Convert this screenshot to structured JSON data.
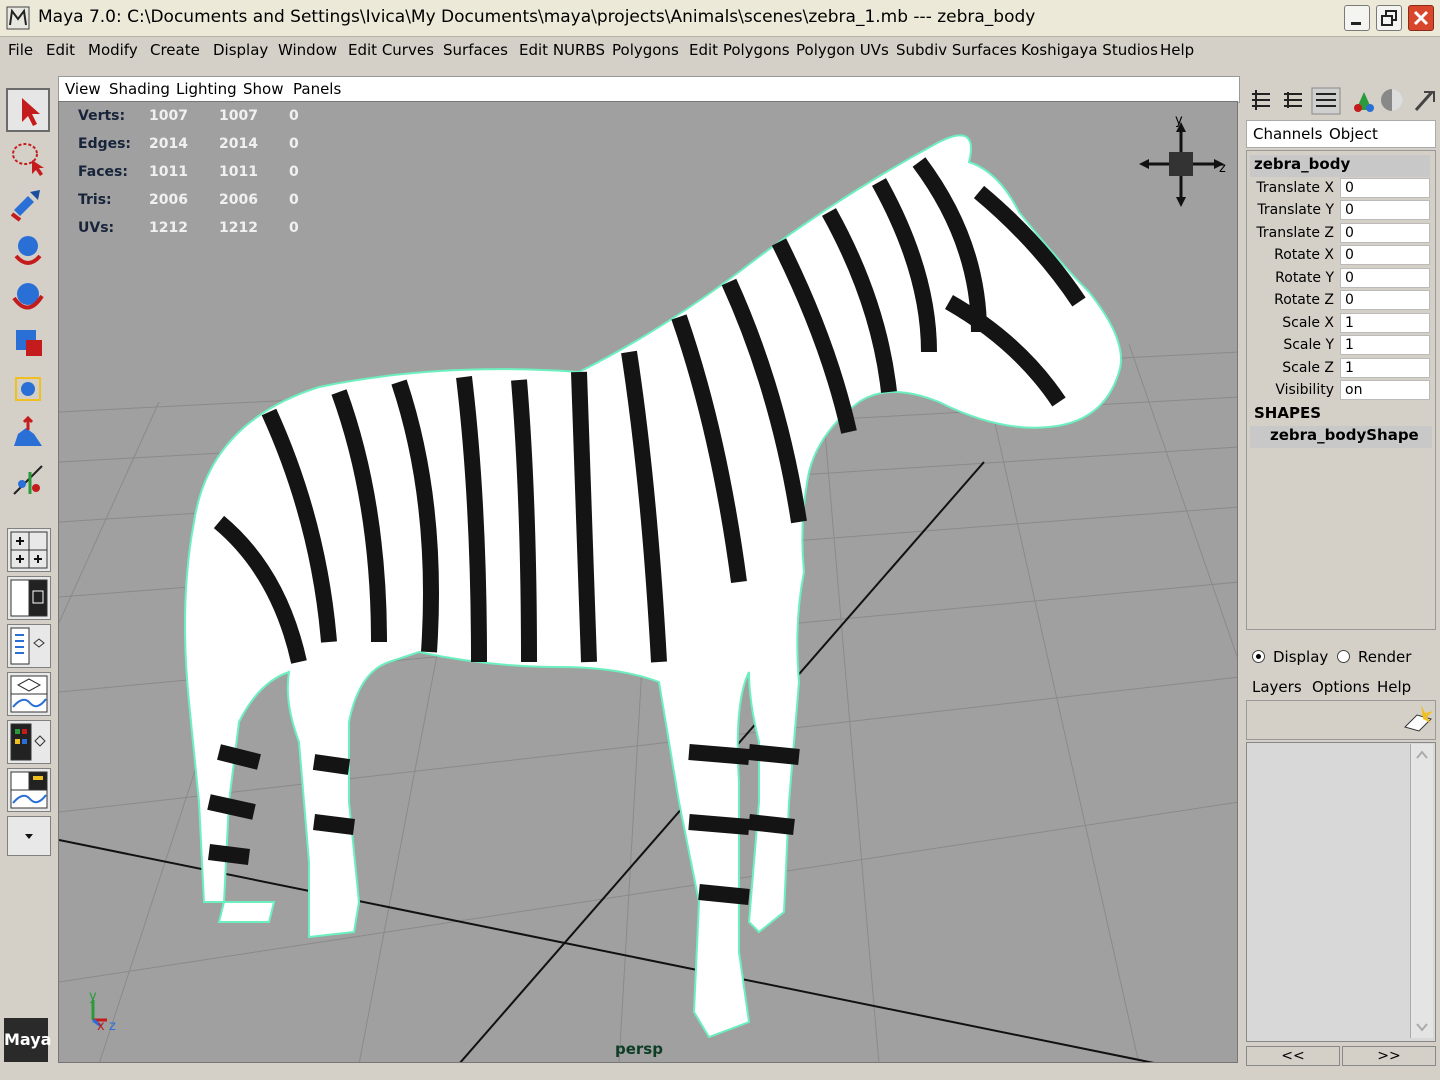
{
  "window": {
    "title": "Maya 7.0: C:\\Documents and Settings\\Ivica\\My Documents\\maya\\projects\\Animals\\scenes\\zebra_1.mb   ---   zebra_body"
  },
  "menubar": [
    "File",
    "Edit",
    "Modify",
    "Create",
    "Display",
    "Window",
    "Edit Curves",
    "Surfaces",
    "Edit NURBS",
    "Polygons",
    "Edit Polygons",
    "Polygon UVs",
    "Subdiv Surfaces",
    "Koshigaya Studios",
    "Help"
  ],
  "panel_menu": [
    "View",
    "Shading",
    "Lighting",
    "Show",
    "Panels"
  ],
  "hud": {
    "rows": [
      {
        "label": "Verts:",
        "a": "1007",
        "b": "1007",
        "c": "0"
      },
      {
        "label": "Edges:",
        "a": "2014",
        "b": "2014",
        "c": "0"
      },
      {
        "label": "Faces:",
        "a": "1011",
        "b": "1011",
        "c": "0"
      },
      {
        "label": "Tris:",
        "a": "2006",
        "b": "2006",
        "c": "0"
      },
      {
        "label": "UVs:",
        "a": "1212",
        "b": "1212",
        "c": "0"
      }
    ]
  },
  "viewport": {
    "camera": "persp",
    "view_cube": {
      "y": "y",
      "z": "z"
    },
    "axis": {
      "y": "y",
      "x": "x",
      "z": "z"
    }
  },
  "channel_box": {
    "tabs": [
      "Channels",
      "Object"
    ],
    "object": "zebra_body",
    "attributes": [
      {
        "name": "Translate X",
        "value": "0"
      },
      {
        "name": "Translate Y",
        "value": "0"
      },
      {
        "name": "Translate Z",
        "value": "0"
      },
      {
        "name": "Rotate X",
        "value": "0"
      },
      {
        "name": "Rotate Y",
        "value": "0"
      },
      {
        "name": "Rotate Z",
        "value": "0"
      },
      {
        "name": "Scale X",
        "value": "1"
      },
      {
        "name": "Scale Y",
        "value": "1"
      },
      {
        "name": "Scale Z",
        "value": "1"
      },
      {
        "name": "Visibility",
        "value": "on"
      }
    ],
    "shapes_header": "SHAPES",
    "shape": "zebra_bodyShape"
  },
  "layer_editor": {
    "radio_display": "Display",
    "radio_render": "Render",
    "menu": [
      "Layers",
      "Options",
      "Help"
    ],
    "prev": "<<",
    "next": ">>"
  },
  "logo": "Maya",
  "colors": {
    "wire": "#6cf0c0",
    "viewport_bg": "#a0a0a0",
    "hud_label": "#17243a"
  }
}
